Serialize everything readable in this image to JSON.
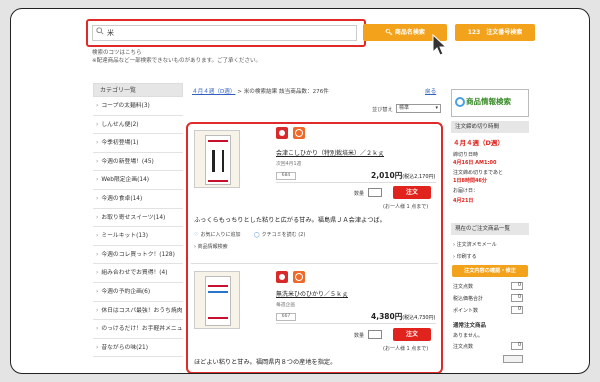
{
  "search": {
    "value": "米",
    "name_search_label": "商品名検索",
    "order_search_label": "123　注文番号検索"
  },
  "tips": [
    "検索のコツはこちら",
    "※配達商品など一部検索できないものがあります。ご了承ください。"
  ],
  "sidebar": {
    "header": "カテゴリ一覧",
    "items": [
      "コープの太麺料(3)",
      "しんせん便(2)",
      "今季初登場(1)",
      "今週の新登場！(45)",
      "Web限定企画(14)",
      "今週の食卓(14)",
      "お取り寄せスイーツ(14)",
      "ミールキット(13)",
      "今週のコレ買っトク！(128)",
      "組み合わせでお買得！(4)",
      "今週の予約企画(6)",
      "休日はコスパ最強！おうち焼肉(14)",
      "のっけるだけ！お手軽丼メニュー(12)",
      "昔ながらの味(21)"
    ]
  },
  "breadcrumb": {
    "week_link": "４月４週（D週）",
    "rest": " > 米の検索結果 該当商品数：276件"
  },
  "back_label": "戻る",
  "sort": {
    "label": "並び替え",
    "value": "標準"
  },
  "products": [
    {
      "title": "会津こしひかり（特別栽培米）／２ｋｇ",
      "sub": "次回4月1週",
      "code": "684",
      "price": "2,010円",
      "price_tax": "(税込2,170円)",
      "qty_label": "数量",
      "order_label": "注文",
      "limit": "(お一人様 1 点まで)",
      "desc": "ふっくらもっちりとした粘りと広がる甘み。福島県ＪＡ会津よつば。",
      "fav_label": "お気に入りに追加",
      "review_label": "クチコミを読む",
      "review_count": "(2)",
      "info_label": "商品情報検索"
    },
    {
      "title": "無洗米ひのひかり／５ｋｇ",
      "sub": "毎週企画",
      "code": "667",
      "price": "4,380円",
      "price_tax": "(税込4,730円)",
      "qty_label": "数量",
      "order_label": "注文",
      "limit": "(お一人様 1 点まで)",
      "desc": "ほどよい粘りと甘み。福岡県内８つの産地を指定。"
    }
  ],
  "right": {
    "banner": "商品情報検索",
    "deadline_header": "注文締め切り時間",
    "week": "４月４週（D週）",
    "deadline_label": "締切り日時",
    "deadline_value": "4月16日 AM1:00",
    "remaining_label": "注文締め切りまであと",
    "remaining_value": "1日8時間46分",
    "delivery_label": "お届け日：",
    "delivery_value": "4月21日",
    "order_header": "現在のご注文商品一覧",
    "memo_label": "注文済メモメール",
    "print_label": "印刷する",
    "confirm_btn": "注文内容の確認・修正",
    "count_label": "注文点数",
    "count_value": "0",
    "total_label": "税込価格合計",
    "total_value": "0",
    "points_label": "ポイント数",
    "points_value": "0",
    "normal_header": "通常注文商品",
    "normal_none": "ありません。",
    "sub_points_label": "注文点数",
    "sub_points_value": "0"
  },
  "colors": {
    "accent_orange": "#f3a21b",
    "highlight_red": "#e02a2a",
    "order_red": "#e0231c"
  }
}
